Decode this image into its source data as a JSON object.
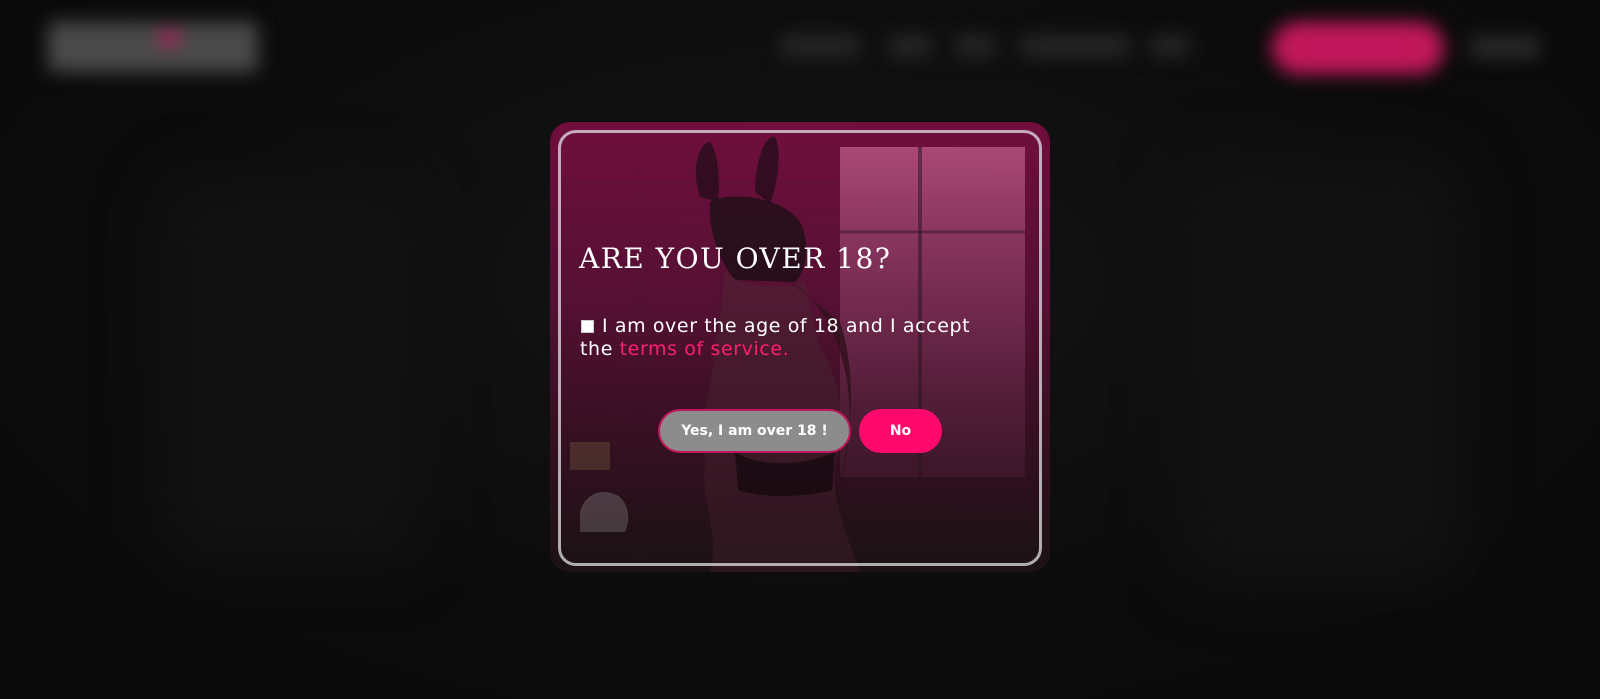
{
  "age_gate": {
    "title": "ARE YOU OVER 18?",
    "consent_text": "I am over the age of 18 and I accept the",
    "terms_link": "terms of service.",
    "yes_button": "Yes, I am over 18 !",
    "no_button": "No"
  },
  "colors": {
    "accent": "#ff0a6c",
    "link": "#ff1f6d",
    "modal_tint": "#780e40",
    "yes_button_bg": "#8c8c8c",
    "page_bg": "#0b0b0b"
  },
  "icons": {
    "consent_checkbox": "checkbox-unchecked-icon"
  }
}
